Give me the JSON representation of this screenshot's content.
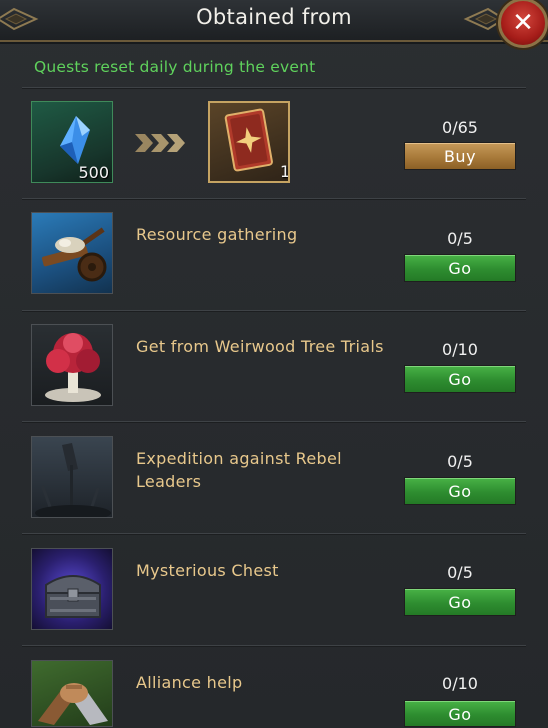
{
  "header": {
    "title": "Obtained from",
    "close_icon": "close-icon"
  },
  "notice": "Quests reset daily during the event",
  "exchange": {
    "cost_icon": "blue-crystal-icon",
    "cost_amount": "500",
    "arrow_icon": "triple-arrow-icon",
    "reward_icon": "red-card-icon",
    "reward_amount": "1",
    "count": "0/65",
    "button_label": "Buy"
  },
  "sources": [
    {
      "icon": "resource-cart-icon",
      "label": "Resource gathering",
      "count": "0/5",
      "button_label": "Go"
    },
    {
      "icon": "weirwood-tree-icon",
      "label": "Get from Weirwood Tree Trials",
      "count": "0/10",
      "button_label": "Go"
    },
    {
      "icon": "rebel-leaders-icon",
      "label": "Expedition against Rebel Leaders",
      "count": "0/5",
      "button_label": "Go"
    },
    {
      "icon": "treasure-chest-icon",
      "label": "Mysterious Chest",
      "count": "0/5",
      "button_label": "Go"
    },
    {
      "icon": "handshake-icon",
      "label": "Alliance help",
      "count": "0/10",
      "button_label": "Go"
    }
  ],
  "colors": {
    "notice": "#5fd25c",
    "source_label": "#e8c88c",
    "go_button": "#2e8d30",
    "buy_button": "#a87a3a",
    "close_button": "#a61d19"
  }
}
